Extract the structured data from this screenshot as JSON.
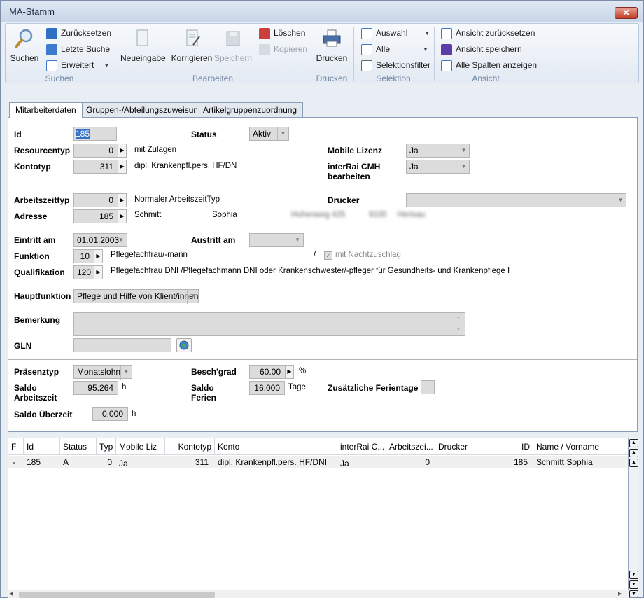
{
  "window": {
    "title": "MA-Stamm",
    "close": "✕"
  },
  "ribbon": {
    "suchen": {
      "label": "Suchen",
      "search": "Suchen",
      "reset": "Zurücksetzen",
      "last": "Letzte Suche",
      "extended": "Erweitert"
    },
    "bearbeiten": {
      "label": "Bearbeiten",
      "new": "Neueingabe",
      "correct": "Korrigieren",
      "save": "Speichern",
      "delete": "Löschen",
      "copy": "Kopieren"
    },
    "drucken": {
      "label": "Drucken",
      "print": "Drucken"
    },
    "selektion": {
      "label": "Selektion",
      "choice": "Auswahl",
      "all": "Alle",
      "filter": "Selektionsfilter"
    },
    "ansicht": {
      "label": "Ansicht",
      "reset_view": "Ansicht zurücksetzen",
      "save_view": "Ansicht speichern",
      "show_cols": "Alle Spalten anzeigen"
    }
  },
  "tabs": [
    "Mitarbeiterdaten",
    "Gruppen-/Abteilungszuweisung",
    "Artikelgruppenzuordnung"
  ],
  "form": {
    "id": {
      "label": "Id",
      "value": "185"
    },
    "status": {
      "label": "Status",
      "value": "Aktiv"
    },
    "resourcentyp": {
      "label": "Resourcentyp",
      "value": "0",
      "text": "mit Zulagen"
    },
    "mobile_lizenz": {
      "label": "Mobile Lizenz",
      "value": "Ja"
    },
    "kontotyp": {
      "label": "Kontotyp",
      "value": "311",
      "text": "dipl. Krankenpfl.pers. HF/DN"
    },
    "interrai": {
      "label1": "interRai CMH",
      "label2": "bearbeiten",
      "value": "Ja"
    },
    "arbeitszeittyp": {
      "label": "Arbeitszeittyp",
      "value": "0",
      "text": "Normaler ArbeitszeitTyp"
    },
    "drucker": {
      "label": "Drucker",
      "value": ""
    },
    "adresse": {
      "label": "Adresse",
      "value": "185",
      "name": "Schmitt",
      "first": "Sophia",
      "street": "Hohenweg 425",
      "zip": "9100",
      "city": "Herisau"
    },
    "eintritt": {
      "label": "Eintritt am",
      "value": "01.01.2003"
    },
    "austritt": {
      "label": "Austritt am",
      "value": ""
    },
    "funktion": {
      "label": "Funktion",
      "value": "10",
      "text": "Pflegefachfrau/-mann",
      "slash": "/",
      "night": "mit Nachtzuschlag"
    },
    "qualifikation": {
      "label": "Qualifikation",
      "value": "120",
      "text": "Pflegefachfrau DNI /Pflegefachmann DNI oder Krankenschwester/-pfleger für Gesundheits- und Krankenpflege I"
    },
    "hauptfunktion": {
      "label": "Hauptfunktion",
      "value": "Pflege und Hilfe von Klient/innen"
    },
    "bemerkung": {
      "label": "Bemerkung",
      "value": ""
    },
    "gln": {
      "label": "GLN",
      "value": ""
    },
    "praesenztyp": {
      "label": "Präsenztyp",
      "value": "Monatslohn"
    },
    "beschgrad": {
      "label": "Besch'grad",
      "value": "60.00",
      "unit": "%"
    },
    "saldo_az": {
      "label1": "Saldo",
      "label2": "Arbeitszeit",
      "value": "95.264",
      "unit": "h"
    },
    "saldo_ferien": {
      "label1": "Saldo",
      "label2": "Ferien",
      "value": "16.000",
      "unit": "Tage"
    },
    "zus_ferien": {
      "label": "Zusätzliche Ferientage",
      "value": ""
    },
    "saldo_ueberzeit": {
      "label": "Saldo Überzeit",
      "value": "0.000",
      "unit": "h"
    }
  },
  "grid": {
    "columns": [
      "F",
      "Id",
      "Status",
      "Typ",
      "Mobile Liz",
      "Kontotyp",
      "Konto",
      "interRai C...",
      "Arbeitszei...",
      "Drucker",
      "ID",
      "Name / Vorname"
    ],
    "row": [
      "-",
      "185",
      "A",
      "0",
      "Ja",
      "311",
      "dipl. Krankenpfl.pers. HF/DNI",
      "Ja",
      "0",
      "",
      "185",
      "Schmitt Sophia"
    ]
  }
}
